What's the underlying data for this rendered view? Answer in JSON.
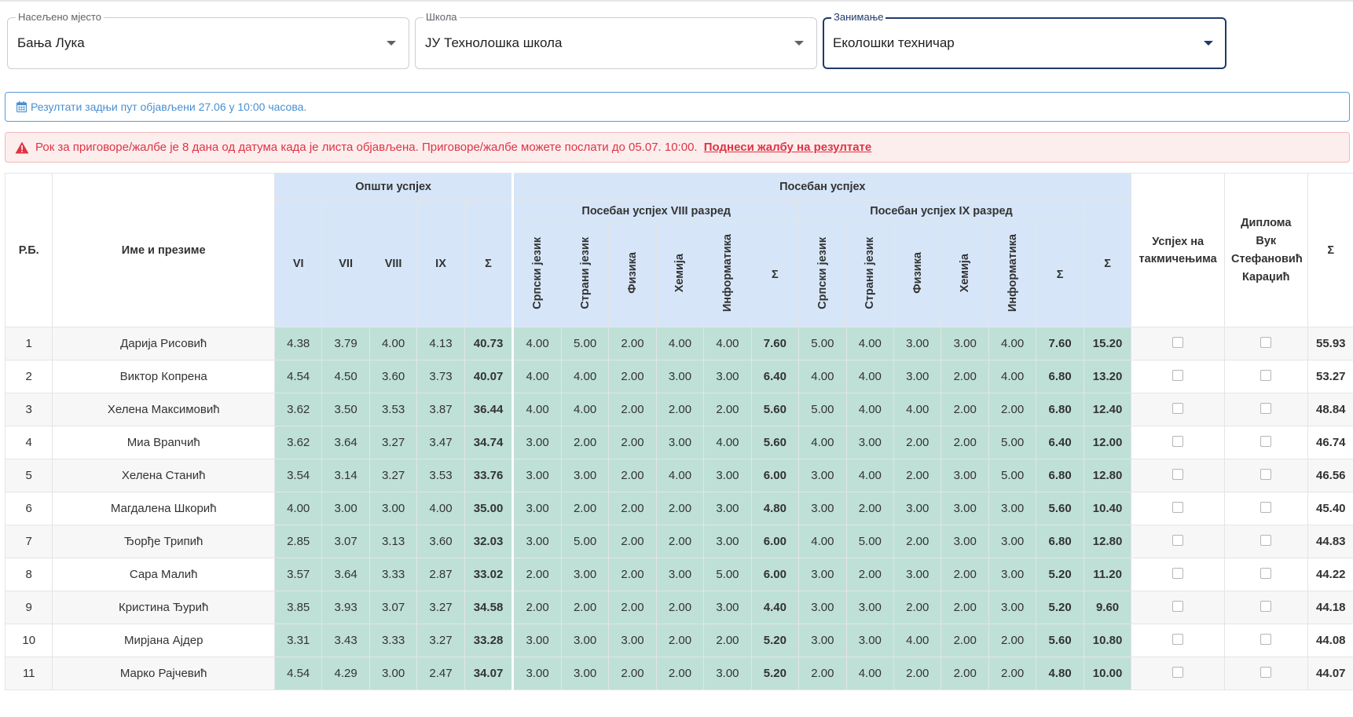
{
  "filters": {
    "city": {
      "label": "Насељено мјесто",
      "value": "Бања Лука"
    },
    "school": {
      "label": "Школа",
      "value": "ЈУ Технолошка школа"
    },
    "occupation": {
      "label": "Занимање",
      "value": "Еколошки техничар"
    }
  },
  "info_alert": {
    "text": "Резултати задњи пут објављени 27.06 у 10:00 часова."
  },
  "danger_alert": {
    "text": "Рок за приговоре/жалбе је 8 дана од датума када је листа објављена. Приговоре/жалбе можете послати до 05.07. 10:00.",
    "link": "Поднеси жалбу на резултате"
  },
  "table": {
    "headers": {
      "rb": "Р.Б.",
      "name": "Име и презиме",
      "general": "Општи успјех",
      "general_cols": [
        "VI",
        "VII",
        "VIII",
        "IX",
        "Σ"
      ],
      "special": "Посебан успјех",
      "special_viii": "Посебан успјех VIII разред",
      "special_ix": "Посебан успјех IX разред",
      "subjects": [
        "Српски језик",
        "Страни језик",
        "Физика",
        "Хемија",
        "Информатика",
        "Σ"
      ],
      "special_sum": "Σ",
      "competitions": "Успјех на такмичењима",
      "diploma": "Диплома Вук Стефановић Караџић",
      "total": "Σ"
    },
    "rows": [
      {
        "rb": "1",
        "name": "Дарија Рисовић",
        "g": [
          "4.38",
          "3.79",
          "4.00",
          "4.13",
          "40.73"
        ],
        "s8": [
          "4.00",
          "5.00",
          "2.00",
          "4.00",
          "4.00",
          "7.60"
        ],
        "s9": [
          "5.00",
          "4.00",
          "3.00",
          "3.00",
          "4.00",
          "7.60"
        ],
        "ssum": "15.20",
        "total": "55.93"
      },
      {
        "rb": "2",
        "name": "Виктор Копрена",
        "g": [
          "4.54",
          "4.50",
          "3.60",
          "3.73",
          "40.07"
        ],
        "s8": [
          "4.00",
          "4.00",
          "2.00",
          "3.00",
          "3.00",
          "6.40"
        ],
        "s9": [
          "4.00",
          "4.00",
          "3.00",
          "2.00",
          "4.00",
          "6.80"
        ],
        "ssum": "13.20",
        "total": "53.27"
      },
      {
        "rb": "3",
        "name": "Хелена Максимовић",
        "g": [
          "3.62",
          "3.50",
          "3.53",
          "3.87",
          "36.44"
        ],
        "s8": [
          "4.00",
          "4.00",
          "2.00",
          "2.00",
          "2.00",
          "5.60"
        ],
        "s9": [
          "5.00",
          "4.00",
          "4.00",
          "2.00",
          "2.00",
          "6.80"
        ],
        "ssum": "12.40",
        "total": "48.84"
      },
      {
        "rb": "4",
        "name": "Миа Врanчић",
        "g": [
          "3.62",
          "3.64",
          "3.27",
          "3.47",
          "34.74"
        ],
        "s8": [
          "3.00",
          "2.00",
          "2.00",
          "3.00",
          "4.00",
          "5.60"
        ],
        "s9": [
          "4.00",
          "3.00",
          "2.00",
          "2.00",
          "5.00",
          "6.40"
        ],
        "ssum": "12.00",
        "total": "46.74"
      },
      {
        "rb": "5",
        "name": "Хелена Станић",
        "g": [
          "3.54",
          "3.14",
          "3.27",
          "3.53",
          "33.76"
        ],
        "s8": [
          "3.00",
          "3.00",
          "2.00",
          "4.00",
          "3.00",
          "6.00"
        ],
        "s9": [
          "3.00",
          "4.00",
          "2.00",
          "3.00",
          "5.00",
          "6.80"
        ],
        "ssum": "12.80",
        "total": "46.56"
      },
      {
        "rb": "6",
        "name": "Магдалена Шкорић",
        "g": [
          "4.00",
          "3.00",
          "3.00",
          "4.00",
          "35.00"
        ],
        "s8": [
          "3.00",
          "2.00",
          "2.00",
          "2.00",
          "3.00",
          "4.80"
        ],
        "s9": [
          "3.00",
          "2.00",
          "3.00",
          "3.00",
          "3.00",
          "5.60"
        ],
        "ssum": "10.40",
        "total": "45.40"
      },
      {
        "rb": "7",
        "name": "Ђорђе Трипић",
        "g": [
          "2.85",
          "3.07",
          "3.13",
          "3.60",
          "32.03"
        ],
        "s8": [
          "3.00",
          "5.00",
          "2.00",
          "2.00",
          "3.00",
          "6.00"
        ],
        "s9": [
          "4.00",
          "5.00",
          "2.00",
          "3.00",
          "3.00",
          "6.80"
        ],
        "ssum": "12.80",
        "total": "44.83"
      },
      {
        "rb": "8",
        "name": "Сара Малић",
        "g": [
          "3.57",
          "3.64",
          "3.33",
          "2.87",
          "33.02"
        ],
        "s8": [
          "2.00",
          "3.00",
          "2.00",
          "3.00",
          "5.00",
          "6.00"
        ],
        "s9": [
          "3.00",
          "2.00",
          "3.00",
          "2.00",
          "3.00",
          "5.20"
        ],
        "ssum": "11.20",
        "total": "44.22"
      },
      {
        "rb": "9",
        "name": "Кристина Ђурић",
        "g": [
          "3.85",
          "3.93",
          "3.07",
          "3.27",
          "34.58"
        ],
        "s8": [
          "2.00",
          "2.00",
          "2.00",
          "2.00",
          "3.00",
          "4.40"
        ],
        "s9": [
          "3.00",
          "3.00",
          "2.00",
          "2.00",
          "3.00",
          "5.20"
        ],
        "ssum": "9.60",
        "total": "44.18"
      },
      {
        "rb": "10",
        "name": "Мирјана Ајдер",
        "g": [
          "3.31",
          "3.43",
          "3.33",
          "3.27",
          "33.28"
        ],
        "s8": [
          "3.00",
          "3.00",
          "3.00",
          "2.00",
          "2.00",
          "5.20"
        ],
        "s9": [
          "3.00",
          "3.00",
          "4.00",
          "2.00",
          "2.00",
          "5.60"
        ],
        "ssum": "10.80",
        "total": "44.08"
      },
      {
        "rb": "11",
        "name": "Марко Рајчевић",
        "g": [
          "4.54",
          "4.29",
          "3.00",
          "2.47",
          "34.07"
        ],
        "s8": [
          "3.00",
          "3.00",
          "2.00",
          "2.00",
          "3.00",
          "5.20"
        ],
        "s9": [
          "2.00",
          "4.00",
          "2.00",
          "2.00",
          "2.00",
          "4.80"
        ],
        "ssum": "10.00",
        "total": "44.07"
      }
    ]
  }
}
